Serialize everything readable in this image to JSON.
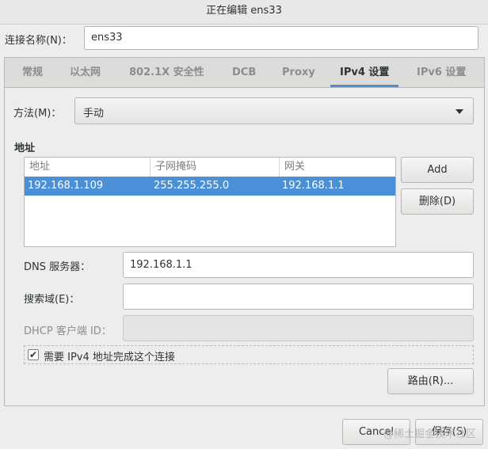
{
  "window": {
    "title": "正在编辑 ens33"
  },
  "connection": {
    "label": "连接名称(N)：",
    "value": "ens33"
  },
  "tabs": [
    {
      "label": "常规"
    },
    {
      "label": "以太网"
    },
    {
      "label": "802.1X 安全性"
    },
    {
      "label": "DCB"
    },
    {
      "label": "Proxy"
    },
    {
      "label": "IPv4 设置",
      "active": true
    },
    {
      "label": "IPv6 设置"
    }
  ],
  "method": {
    "label": "方法(M)：",
    "value": "手动"
  },
  "addresses": {
    "title": "地址",
    "columns": [
      "地址",
      "子网掩码",
      "网关"
    ],
    "rows": [
      {
        "address": "192.168.1.109",
        "netmask": "255.255.255.0",
        "gateway": "192.168.1.1"
      }
    ],
    "add_label": "Add",
    "delete_label": "删除(D)"
  },
  "dns": {
    "label": "DNS 服务器：",
    "value": "192.168.1.1"
  },
  "search": {
    "label": "搜索域(E)：",
    "value": ""
  },
  "dhcp": {
    "label": "DHCP 客户端 ID：",
    "value": ""
  },
  "require": {
    "label": "需要 IPv4 地址完成这个连接",
    "checked": true,
    "check_glyph": "✔"
  },
  "routes_label": "路由(R)...",
  "footer": {
    "cancel_label": "Cancel",
    "save_label": "保存(S)"
  },
  "watermark": "@稀土掘金技术社区",
  "colors": {
    "accent": "#4a90d9"
  }
}
